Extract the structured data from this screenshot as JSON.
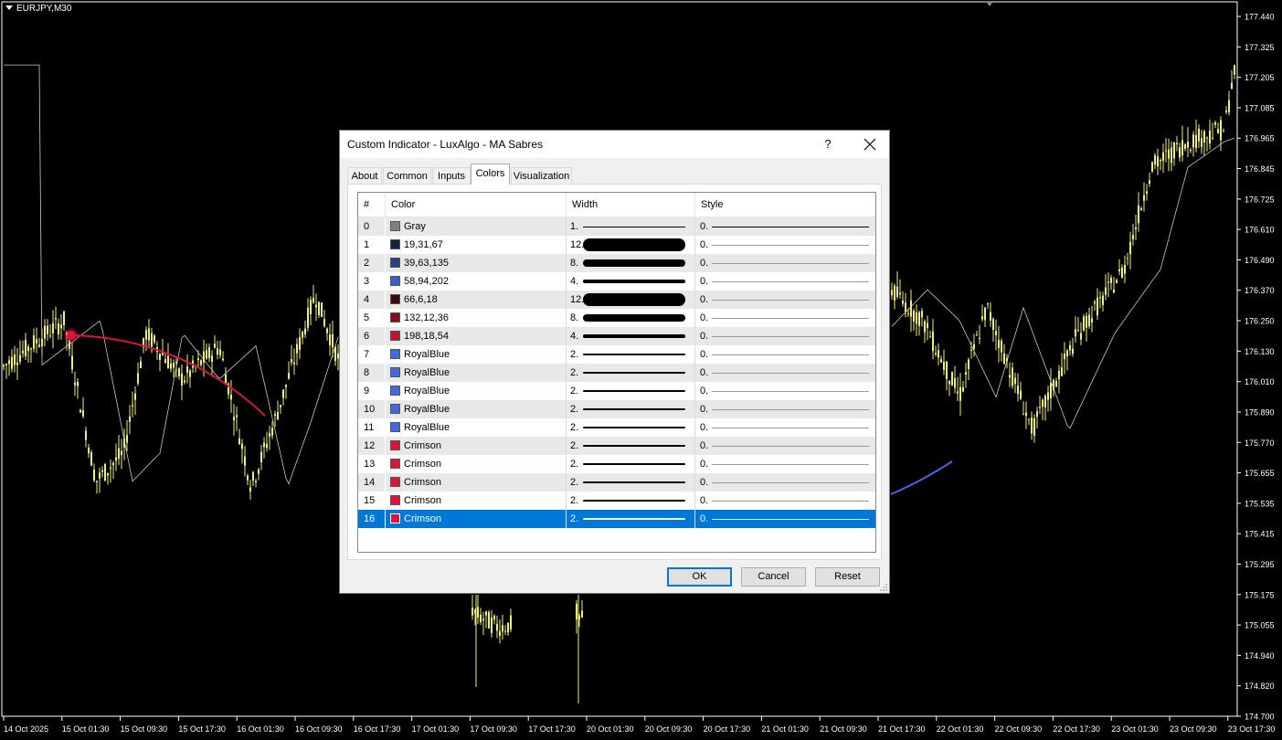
{
  "symbol": "EURJPY,M30",
  "price_axis": [
    "177.440",
    "177.325",
    "177.205",
    "177.085",
    "176.965",
    "176.845",
    "176.725",
    "176.610",
    "176.490",
    "176.370",
    "176.250",
    "176.130",
    "176.010",
    "175.890",
    "175.770",
    "175.655",
    "175.535",
    "175.415",
    "175.295",
    "175.175",
    "175.055",
    "174.940",
    "174.820",
    "174.700"
  ],
  "time_axis": [
    "14 Oct 2025",
    "15 Oct 01:30",
    "15 Oct 09:30",
    "15 Oct 17:30",
    "16 Oct 01:30",
    "16 Oct 09:30",
    "16 Oct 17:30",
    "17 Oct 01:30",
    "17 Oct 09:30",
    "17 Oct 17:30",
    "20 Oct 01:30",
    "20 Oct 09:30",
    "20 Oct 17:30",
    "21 Oct 01:30",
    "21 Oct 09:30",
    "21 Oct 17:30",
    "22 Oct 01:30",
    "22 Oct 09:30",
    "22 Oct 17:30",
    "23 Oct 01:30",
    "23 Oct 09:30",
    "23 Oct 17:30"
  ],
  "colors": {
    "background": "#000000",
    "candle": "#f0f07a",
    "ma_line": "#c8c8c8",
    "bear_sabre": "#dc143c",
    "bull_sabre": "#4169e1",
    "selection": "#0078d7"
  },
  "dialog": {
    "title": "Custom Indicator - LuxAlgo - MA Sabres",
    "help_label": "?",
    "close_icon": "close-icon",
    "tabs": [
      {
        "label": "About"
      },
      {
        "label": "Common"
      },
      {
        "label": "Inputs"
      },
      {
        "label": "Colors"
      },
      {
        "label": "Visualization"
      }
    ],
    "active_tab": "Colors",
    "columns": {
      "idx": "#",
      "color": "Color",
      "width": "Width",
      "style": "Style"
    },
    "rows": [
      {
        "idx": "0",
        "color_name": "Gray",
        "swatch": "#808080",
        "width": "1.",
        "weight": 1,
        "style": "0."
      },
      {
        "idx": "1",
        "color_name": "19,31,67",
        "swatch": "#131f43",
        "width": "12.",
        "weight": 12,
        "style": "0."
      },
      {
        "idx": "2",
        "color_name": "39,63,135",
        "swatch": "#273f87",
        "width": "8.",
        "weight": 8,
        "style": "0."
      },
      {
        "idx": "3",
        "color_name": "58,94,202",
        "swatch": "#3a5eca",
        "width": "4.",
        "weight": 4,
        "style": "0."
      },
      {
        "idx": "4",
        "color_name": "66,6,18",
        "swatch": "#420612",
        "width": "12.",
        "weight": 12,
        "style": "0."
      },
      {
        "idx": "5",
        "color_name": "132,12,36",
        "swatch": "#840c24",
        "width": "8.",
        "weight": 8,
        "style": "0."
      },
      {
        "idx": "6",
        "color_name": "198,18,54",
        "swatch": "#c61236",
        "width": "4.",
        "weight": 4,
        "style": "0."
      },
      {
        "idx": "7",
        "color_name": "RoyalBlue",
        "swatch": "#4169e1",
        "width": "2.",
        "weight": 2,
        "style": "0."
      },
      {
        "idx": "8",
        "color_name": "RoyalBlue",
        "swatch": "#4169e1",
        "width": "2.",
        "weight": 2,
        "style": "0."
      },
      {
        "idx": "9",
        "color_name": "RoyalBlue",
        "swatch": "#4169e1",
        "width": "2.",
        "weight": 2,
        "style": "0."
      },
      {
        "idx": "10",
        "color_name": "RoyalBlue",
        "swatch": "#4169e1",
        "width": "2.",
        "weight": 2,
        "style": "0."
      },
      {
        "idx": "11",
        "color_name": "RoyalBlue",
        "swatch": "#4169e1",
        "width": "2.",
        "weight": 2,
        "style": "0."
      },
      {
        "idx": "12",
        "color_name": "Crimson",
        "swatch": "#dc143c",
        "width": "2.",
        "weight": 2,
        "style": "0."
      },
      {
        "idx": "13",
        "color_name": "Crimson",
        "swatch": "#dc143c",
        "width": "2.",
        "weight": 2,
        "style": "0."
      },
      {
        "idx": "14",
        "color_name": "Crimson",
        "swatch": "#dc143c",
        "width": "2.",
        "weight": 2,
        "style": "0."
      },
      {
        "idx": "15",
        "color_name": "Crimson",
        "swatch": "#dc143c",
        "width": "2.",
        "weight": 2,
        "style": "0."
      },
      {
        "idx": "16",
        "color_name": "Crimson",
        "swatch": "#dc143c",
        "width": "2.",
        "weight": 2,
        "style": "0.",
        "selected": true
      }
    ],
    "buttons": {
      "ok": "OK",
      "cancel": "Cancel",
      "reset": "Reset"
    }
  }
}
